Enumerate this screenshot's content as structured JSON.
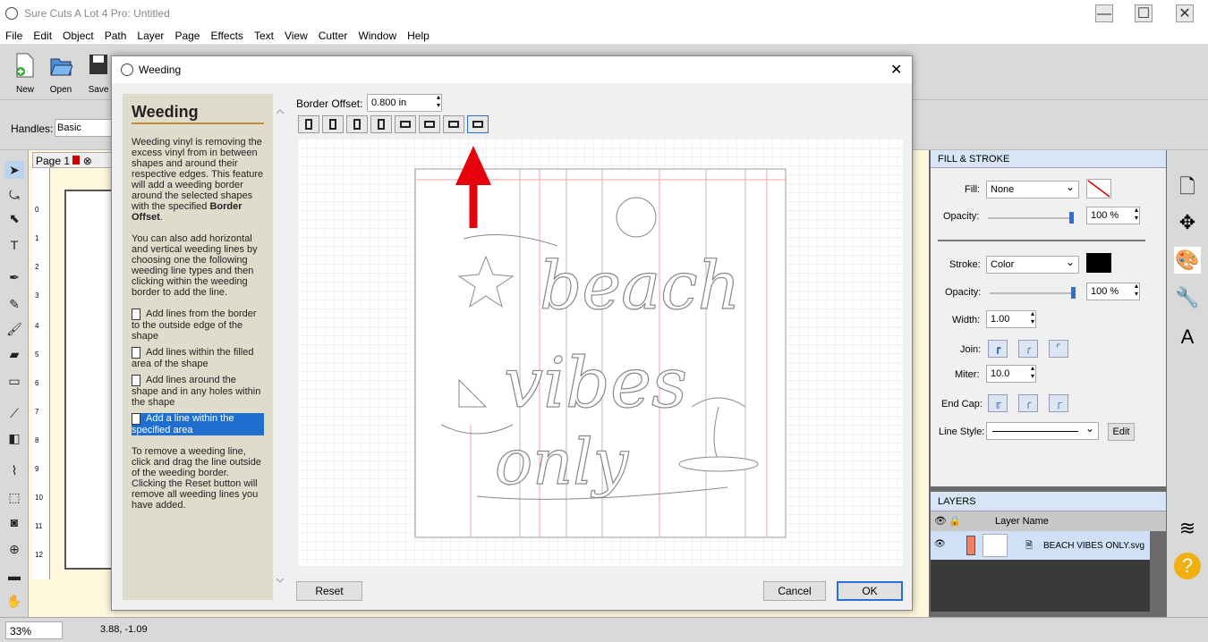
{
  "app": {
    "title": "Sure Cuts A Lot 4 Pro: Untitled",
    "window_controls": [
      "—",
      "☐",
      "✕"
    ]
  },
  "menu": [
    "File",
    "Edit",
    "Object",
    "Path",
    "Layer",
    "Page",
    "Effects",
    "Text",
    "View",
    "Cutter",
    "Window",
    "Help"
  ],
  "toolbar": {
    "new_label": "New",
    "open_label": "Open",
    "save_label": "Save"
  },
  "handles": {
    "label": "Handles:",
    "value": "Basic"
  },
  "page_tab": {
    "label": "Page 1"
  },
  "ruler_ticks": [
    "0",
    "1",
    "2",
    "3",
    "4",
    "5",
    "6",
    "7",
    "8",
    "9",
    "10",
    "11",
    "12"
  ],
  "dialog": {
    "title": "Weeding",
    "close": "✕",
    "help": {
      "heading": "Weeding",
      "intro_1": "Weeding vinyl is removing the excess vinyl from in between shapes and around their respective edges. This feature will add a weeding border around the selected shapes with the specified ",
      "intro_bold": "Border Offset",
      "intro_2": ".",
      "para2": "You can also add horizontal and vertical weeding lines by choosing one the following weeding line types and then clicking within the weeding border to add the line.",
      "options": [
        "Add lines from the border to the outside edge of the shape",
        "Add lines within the filled area of the shape",
        "Add lines around the shape and in any holes within the shape",
        "Add a line within the specified area"
      ],
      "para3": "To remove a weeding line, click and drag the line outside of the weeding border. Clicking the Reset button will remove all weeding lines you have added."
    },
    "border_offset_label": "Border Offset:",
    "border_offset_value": "0.800 in",
    "preview_text": {
      "line1": "beach",
      "line2": "vibes",
      "line3": "only"
    },
    "reset_label": "Reset",
    "cancel_label": "Cancel",
    "ok_label": "OK"
  },
  "fill_stroke": {
    "header": "FILL & STROKE",
    "fill_label": "Fill:",
    "fill_value": "None",
    "opacity_label": "Opacity:",
    "fill_opacity": "100 %",
    "stroke_label": "Stroke:",
    "stroke_value": "Color",
    "stroke_color": "#000000",
    "stroke_opacity": "100 %",
    "width_label": "Width:",
    "width_value": "1.00",
    "join_label": "Join:",
    "miter_label": "Miter:",
    "miter_value": "10.0",
    "endcap_label": "End Cap:",
    "linestyle_label": "Line Style:",
    "edit_label": "Edit"
  },
  "layers": {
    "header": "LAYERS",
    "col_name": "Layer Name",
    "row_name": "BEACH VIBES ONLY.svg"
  },
  "status": {
    "zoom": "33%",
    "coords": "3.88, -1.09"
  },
  "colors": {
    "accent": "#2a6fdb",
    "arrow": "#e8000d",
    "panel_header": "#d7e5f5"
  }
}
